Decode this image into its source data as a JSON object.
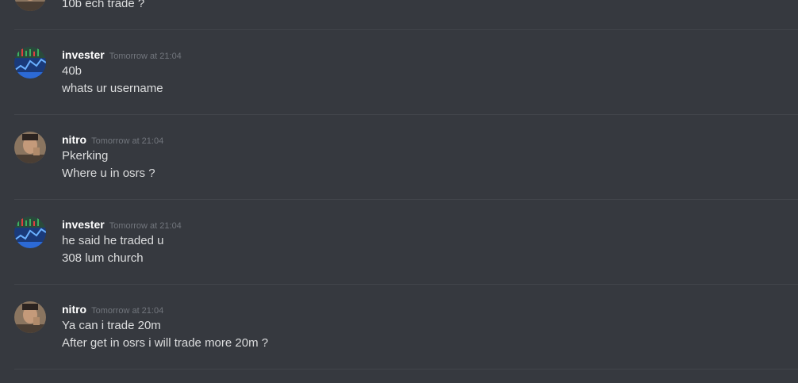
{
  "messages": [
    {
      "author": "",
      "timestamp": "",
      "lines": [
        "10b ech trade ?"
      ],
      "avatar_icon": "nitro-avatar-icon"
    },
    {
      "author": "invester",
      "timestamp": "Tomorrow at 21:04",
      "lines": [
        "40b",
        "whats ur username"
      ],
      "avatar_icon": "invester-avatar-icon"
    },
    {
      "author": "nitro",
      "timestamp": "Tomorrow at 21:04",
      "lines": [
        "Pkerking",
        "Where u in osrs ?"
      ],
      "avatar_icon": "nitro-avatar-icon"
    },
    {
      "author": "invester",
      "timestamp": "Tomorrow at 21:04",
      "lines": [
        "he said he traded u",
        "308 lum church"
      ],
      "avatar_icon": "invester-avatar-icon"
    },
    {
      "author": "nitro",
      "timestamp": "Tomorrow at 21:04",
      "lines": [
        "Ya can i trade 20m",
        "After get in osrs i will trade more 20m ?"
      ],
      "avatar_icon": "nitro-avatar-icon"
    }
  ],
  "colors": {
    "background": "#36393f",
    "divider": "#42454b",
    "username": "#ffffff",
    "timestamp": "#72767d",
    "message_text": "#dcddde"
  }
}
